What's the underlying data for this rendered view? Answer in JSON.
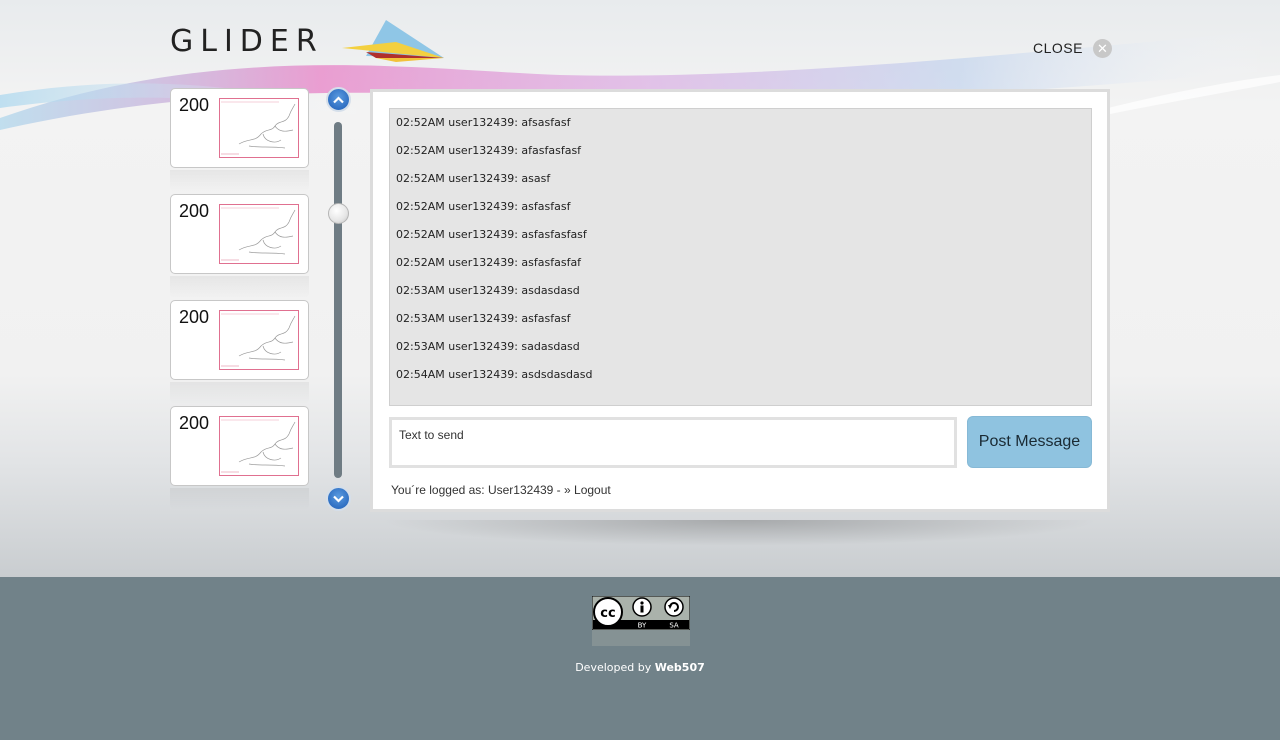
{
  "header": {
    "logo_text": "GLIDER",
    "close_label": "CLOSE"
  },
  "thumbnails": [
    {
      "number": "200"
    },
    {
      "number": "200"
    },
    {
      "number": "200"
    },
    {
      "number": "200"
    }
  ],
  "chat": {
    "messages": [
      {
        "time": "02:52AM",
        "user": "user132439",
        "text": "afsasfasf"
      },
      {
        "time": "02:52AM",
        "user": "user132439",
        "text": "afasfasfasf"
      },
      {
        "time": "02:52AM",
        "user": "user132439",
        "text": "asasf"
      },
      {
        "time": "02:52AM",
        "user": "user132439",
        "text": "asfasfasf"
      },
      {
        "time": "02:52AM",
        "user": "user132439",
        "text": "asfasfasfasf"
      },
      {
        "time": "02:52AM",
        "user": "user132439",
        "text": "asfasfasfaf"
      },
      {
        "time": "02:53AM",
        "user": "user132439",
        "text": "asdasdasd"
      },
      {
        "time": "02:53AM",
        "user": "user132439",
        "text": "asfasfasf"
      },
      {
        "time": "02:53AM",
        "user": "user132439",
        "text": "sadasdasd"
      },
      {
        "time": "02:54AM",
        "user": "user132439",
        "text": "asdsdasdasd"
      }
    ],
    "input_placeholder": "Text to send",
    "post_button_label": "Post Message",
    "logged_prefix": "You´re logged as: User132439 - ",
    "logout_label": "» Logout"
  },
  "footer": {
    "license_badge_text": [
      "BY",
      "SA"
    ],
    "developed_by_prefix": "Developed by",
    "developer_name": "Web507"
  },
  "colors": {
    "footer_bg": "#718289",
    "button_bg": "#8fc3e0",
    "scroll_button": "#2f6fc2"
  }
}
